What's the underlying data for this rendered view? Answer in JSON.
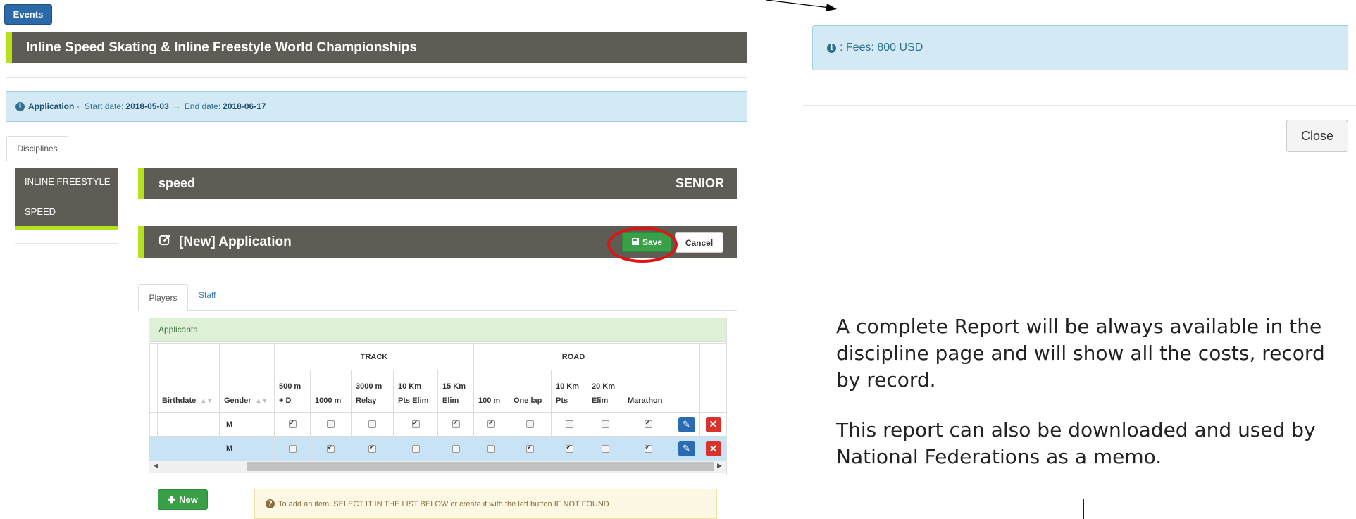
{
  "header": {
    "events_button": "Events",
    "event_title": "Inline Speed Skating & Inline Freestyle World Championships"
  },
  "application_info": {
    "label": "Application",
    "separator": " - ",
    "start_label": "Start date:",
    "start_date": "2018-05-03",
    "arrow": "→",
    "end_label": "End date:",
    "end_date": "2018-06-17"
  },
  "tabs": {
    "disciplines": "Disciplines"
  },
  "sidebar": {
    "items": [
      {
        "label": "INLINE FREESTYLE"
      },
      {
        "label": "SPEED"
      }
    ]
  },
  "discipline_bar": {
    "name": "speed",
    "category": "SENIOR"
  },
  "application_bar": {
    "title": "[New] Application",
    "save_label": "Save",
    "cancel_label": "Cancel"
  },
  "subtabs": {
    "players": "Players",
    "staff": "Staff"
  },
  "applicants": {
    "panel_title": "Applicants",
    "headers": {
      "birthdate": "Birthdate",
      "gender": "Gender",
      "track": "TRACK",
      "road": "ROAD",
      "events": [
        {
          "l1": "500 m",
          "l2": "+ D"
        },
        {
          "l1": "",
          "l2": "1000 m"
        },
        {
          "l1": "3000 m",
          "l2": "Relay"
        },
        {
          "l1": "10 Km",
          "l2": "Pts Elim"
        },
        {
          "l1": "15 Km",
          "l2": "Elim"
        },
        {
          "l1": "",
          "l2": "100 m"
        },
        {
          "l1": "",
          "l2": "One lap"
        },
        {
          "l1": "10 Km",
          "l2": "Pts"
        },
        {
          "l1": "20 Km",
          "l2": "Elim"
        },
        {
          "l1": "",
          "l2": "Marathon"
        }
      ]
    },
    "rows": [
      {
        "gender": "M",
        "checks": [
          true,
          false,
          false,
          true,
          true,
          true,
          false,
          false,
          false,
          true
        ]
      },
      {
        "gender": "M",
        "checks": [
          false,
          true,
          true,
          false,
          false,
          false,
          true,
          true,
          false,
          true
        ]
      }
    ]
  },
  "new_button": "New",
  "hint": "To add an item, SELECT IT IN THE LIST BELOW or create it with the left button IF NOT FOUND",
  "fees": {
    "text": ": Fees: 800 USD"
  },
  "close_button": "Close",
  "annotation": {
    "para1": "A complete Report will be always available in the discipline page and will show all the costs, record by record.",
    "para2": "This report can also be downloaded and used by National Federations as a memo."
  },
  "colors": {
    "accent_green": "#b6e21c",
    "bar_gray": "#5f5c55",
    "save_green": "#3aa047",
    "highlight_red": "#e01313",
    "info_blue": "#d3eaf5"
  }
}
